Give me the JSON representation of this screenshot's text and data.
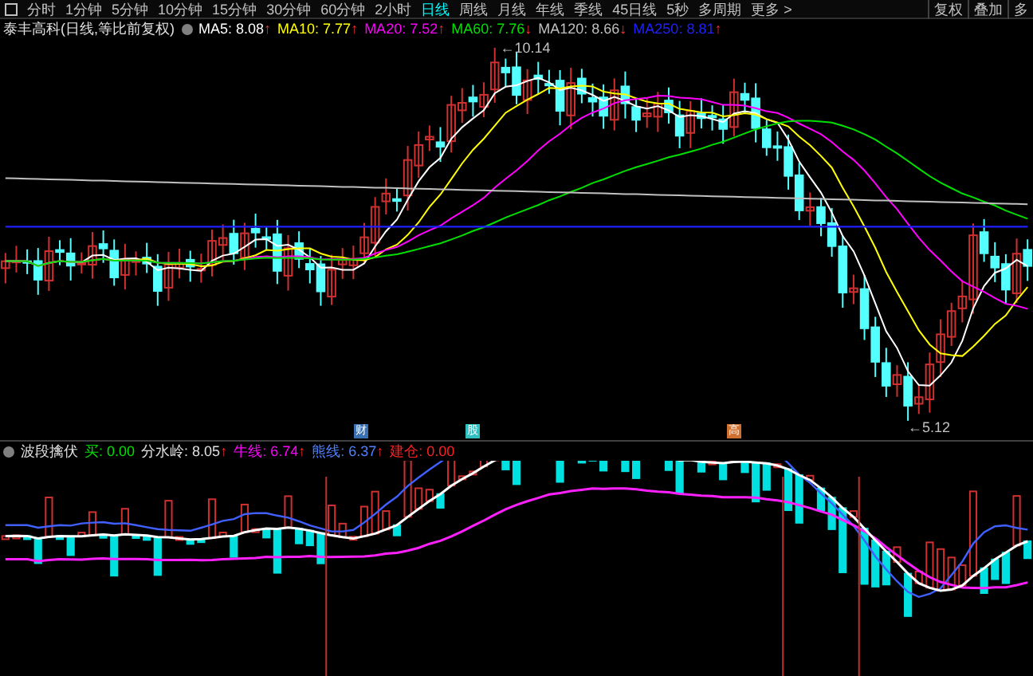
{
  "toolbar": {
    "tabs": [
      {
        "label": "分时",
        "selected": false
      },
      {
        "label": "1分钟",
        "selected": false
      },
      {
        "label": "5分钟",
        "selected": false
      },
      {
        "label": "10分钟",
        "selected": false
      },
      {
        "label": "15分钟",
        "selected": false
      },
      {
        "label": "30分钟",
        "selected": false
      },
      {
        "label": "60分钟",
        "selected": false
      },
      {
        "label": "2小时",
        "selected": false
      },
      {
        "label": "日线",
        "selected": true
      },
      {
        "label": "周线",
        "selected": false
      },
      {
        "label": "月线",
        "selected": false
      },
      {
        "label": "年线",
        "selected": false
      },
      {
        "label": "季线",
        "selected": false
      },
      {
        "label": "45日线",
        "selected": false
      },
      {
        "label": "5秒",
        "selected": false
      },
      {
        "label": "多周期",
        "selected": false
      },
      {
        "label": "更多 >",
        "selected": false
      }
    ],
    "right_buttons": [
      "复权",
      "叠加",
      "多"
    ]
  },
  "main_chart": {
    "title": "泰丰高科(日线,等比前复权)",
    "indicators": [
      {
        "label": "MA5: 8.08",
        "arrow": "↑",
        "color": "#ffffff"
      },
      {
        "label": "MA10: 7.77",
        "arrow": "↑",
        "color": "#ffff00"
      },
      {
        "label": "MA20: 7.52",
        "arrow": "↑",
        "color": "#ff00ff"
      },
      {
        "label": "MA60: 7.76",
        "arrow": "↓",
        "color": "#00e000"
      },
      {
        "label": "MA120: 8.66",
        "arrow": "↓",
        "color": "#c0c0c0"
      },
      {
        "label": "MA250: 8.81",
        "arrow": "↑",
        "color": "#2020ff"
      }
    ],
    "high_label": "←10.14",
    "low_label": "←5.12",
    "markers": [
      {
        "text": "财",
        "color": "#3a6fb0"
      },
      {
        "text": "股",
        "color": "#30c0c0"
      },
      {
        "text": "高",
        "color": "#d07030"
      }
    ]
  },
  "sub_chart": {
    "title": "波段擒伏",
    "indicators": [
      {
        "label": "买: 0.00",
        "color": "#00e000"
      },
      {
        "label": "分水岭: 8.05",
        "arrow": "↑",
        "color": "#e0e0e0"
      },
      {
        "label": "牛线: 6.74",
        "arrow": "↑",
        "color": "#ff00ff"
      },
      {
        "label": "熊线: 6.37",
        "arrow": "↑",
        "color": "#5080ff"
      },
      {
        "label": "建仓: 0.00",
        "color": "#ff2020"
      }
    ]
  }
}
